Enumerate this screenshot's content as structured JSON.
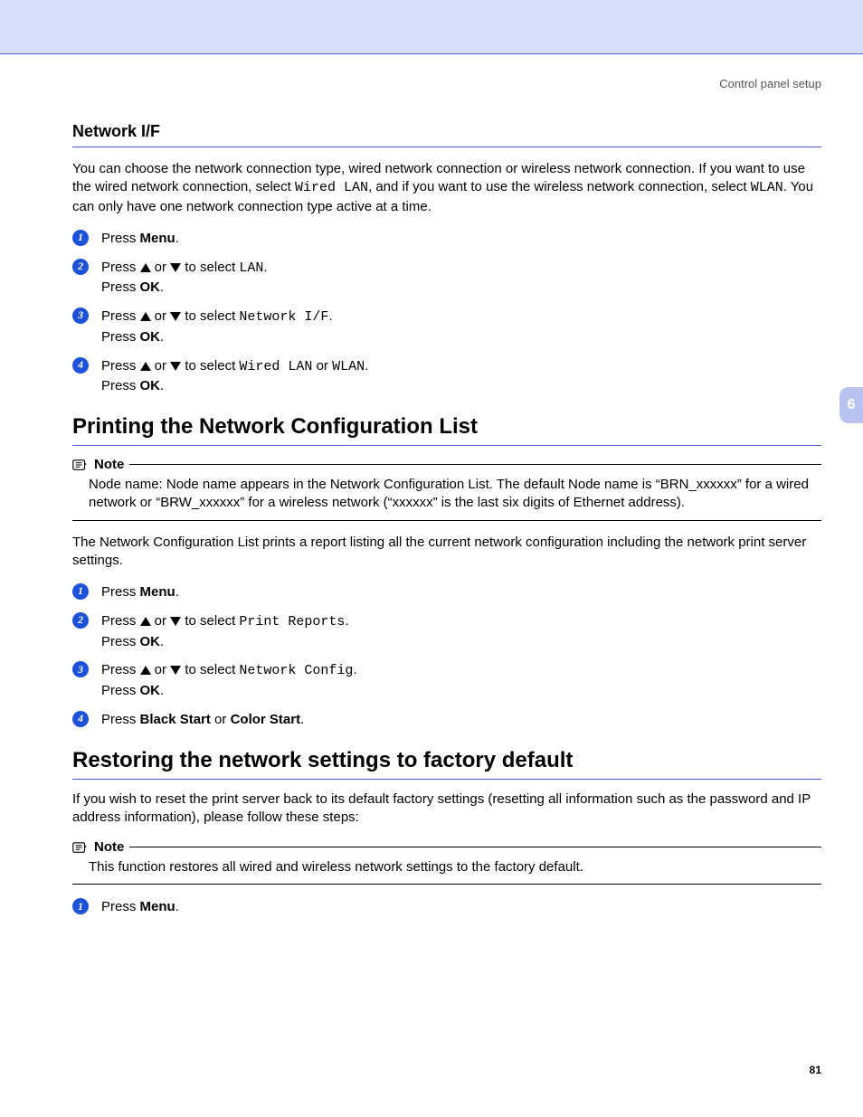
{
  "header": {
    "label": "Control panel setup"
  },
  "chapter_tab": "6",
  "page_number": "81",
  "section1": {
    "title": "Network I/F",
    "id": "6",
    "intro_parts": {
      "p1": "You can choose the network connection type, wired network connection or wireless network connection. If you want to use the wired network connection, select ",
      "m1": "Wired LAN",
      "p2": ", and if you want to use the wireless network connection, select ",
      "m2": "WLAN",
      "p3": ". You can only have one network connection type active at a time."
    },
    "steps": [
      {
        "n": "1",
        "pre": "Press ",
        "b1": "Menu",
        "post": "."
      },
      {
        "n": "2",
        "pre": "Press ",
        "mid": " or ",
        "sel": " to select ",
        "m1": "LAN",
        "end": ".",
        "line2a": "Press ",
        "line2b": "OK",
        "line2c": "."
      },
      {
        "n": "3",
        "pre": "Press ",
        "mid": " or ",
        "sel": " to select ",
        "m1": "Network I/F",
        "end": ".",
        "line2a": "Press ",
        "line2b": "OK",
        "line2c": "."
      },
      {
        "n": "4",
        "pre": "Press ",
        "mid": " or ",
        "sel": " to select ",
        "m1": "Wired LAN",
        "or": " or ",
        "m2": "WLAN",
        "end": ".",
        "line2a": "Press ",
        "line2b": "OK",
        "line2c": "."
      }
    ]
  },
  "section2": {
    "title": "Printing the Network Configuration List",
    "id": "6",
    "note_label": "Note",
    "note_body": "Node name: Node name appears in the Network Configuration List. The default Node name is “BRN_xxxxxx” for a wired network or “BRW_xxxxxx” for a wireless network (“xxxxxx” is the last six digits of Ethernet address).",
    "intro": "The Network Configuration List prints a report listing all the current network configuration including the network print server settings.",
    "steps": [
      {
        "n": "1",
        "pre": "Press ",
        "b1": "Menu",
        "post": "."
      },
      {
        "n": "2",
        "pre": "Press ",
        "mid": " or ",
        "sel": " to select ",
        "m1": "Print Reports",
        "end": ".",
        "line2a": "Press ",
        "line2b": "OK",
        "line2c": "."
      },
      {
        "n": "3",
        "pre": "Press ",
        "mid": " or ",
        "sel": " to select ",
        "m1": "Network Config",
        "end": ".",
        "line2a": "Press ",
        "line2b": "OK",
        "line2c": "."
      },
      {
        "n": "4",
        "pre": "Press ",
        "b1": "Black Start",
        "or": " or ",
        "b2": "Color Start",
        "post": "."
      }
    ]
  },
  "section3": {
    "title": "Restoring the network settings to factory default",
    "id": "6",
    "intro": "If you wish to reset the print server back to its default factory settings (resetting all information such as the password and IP address information), please follow these steps:",
    "note_label": "Note",
    "note_body": "This function restores all wired and wireless network settings to the factory default.",
    "steps": [
      {
        "n": "1",
        "pre": "Press ",
        "b1": "Menu",
        "post": "."
      }
    ]
  }
}
